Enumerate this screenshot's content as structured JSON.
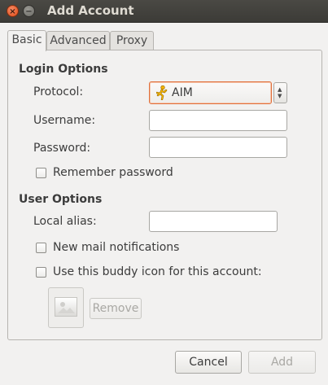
{
  "window": {
    "title": "Add Account",
    "close_glyph": "×",
    "minimize_glyph": "−"
  },
  "tabs": [
    {
      "label": "Basic",
      "active": true
    },
    {
      "label": "Advanced",
      "active": false
    },
    {
      "label": "Proxy",
      "active": false
    }
  ],
  "login_options": {
    "heading": "Login Options",
    "protocol_label": "Protocol:",
    "protocol_value": "AIM",
    "protocol_icon": "aim-running-man-icon",
    "username_label": "Username:",
    "username_value": "",
    "password_label": "Password:",
    "password_value": "",
    "remember_password_label": "Remember password",
    "remember_password_checked": false
  },
  "user_options": {
    "heading": "User Options",
    "local_alias_label": "Local alias:",
    "local_alias_value": "",
    "new_mail_label": "New mail notifications",
    "new_mail_checked": false,
    "buddy_icon_label": "Use this buddy icon for this account:",
    "buddy_icon_checked": false,
    "remove_label": "Remove",
    "remove_enabled": false
  },
  "actions": {
    "cancel_label": "Cancel",
    "add_label": "Add",
    "add_enabled": false
  },
  "colors": {
    "titlebar": "#3c3b37",
    "close_button": "#df4a16",
    "focus_border": "#e0703c",
    "aim_icon": "#f5b400"
  }
}
